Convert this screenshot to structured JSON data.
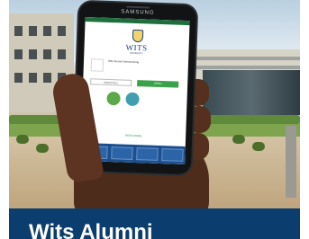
{
  "phone": {
    "brand": "SAMSUNG",
    "screen": {
      "logo_text": "WITS",
      "logo_sub": "UNIVERSITY",
      "app_name": "Wits Alumni Homecoming",
      "app_developer": "",
      "uninstall_label": "UNINSTALL",
      "open_label": "OPEN",
      "read_more_label": "READ MORE"
    }
  },
  "caption": {
    "text": "Wits Alumni"
  },
  "colors": {
    "caption_bg": "#0b3d6e",
    "open_button": "#3aa24a",
    "wits_blue": "#1c3c7a"
  }
}
